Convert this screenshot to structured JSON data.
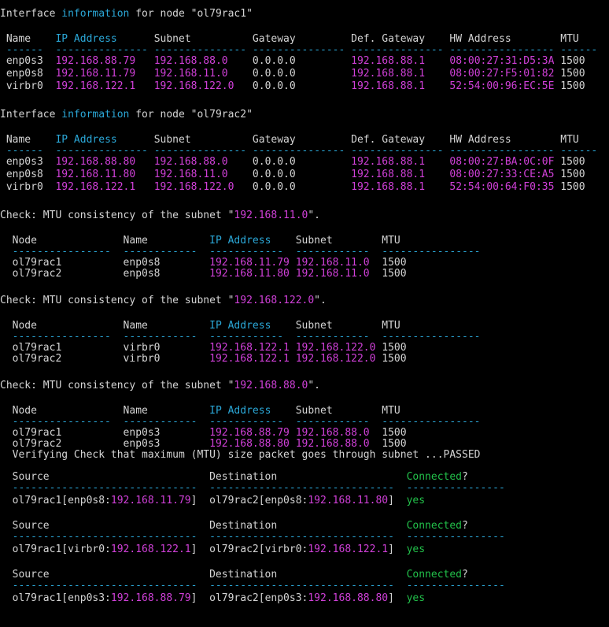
{
  "block1_title_parts": [
    "Interface ",
    "information",
    " for node \"ol79rac1\""
  ],
  "block2_title_parts": [
    "Interface ",
    "information",
    " for node \"ol79rac2\""
  ],
  "iface_headers": [
    "Name",
    "IP Address",
    "Subnet",
    "Gateway",
    "Def. Gateway",
    "HW Address",
    "MTU"
  ],
  "iface_dashes": [
    "------",
    "---------------",
    "---------------",
    "---------------",
    "---------------",
    "-----------------",
    "------"
  ],
  "node1_ifaces": [
    [
      "enp0s3",
      "192.168.88.79",
      "192.168.88.0",
      "0.0.0.0",
      "192.168.88.1",
      "08:00:27:31:D5:3A",
      "1500"
    ],
    [
      "enp0s8",
      "192.168.11.79",
      "192.168.11.0",
      "0.0.0.0",
      "192.168.88.1",
      "08:00:27:F5:01:82",
      "1500"
    ],
    [
      "virbr0",
      "192.168.122.1",
      "192.168.122.0",
      "0.0.0.0",
      "192.168.88.1",
      "52:54:00:96:EC:5E",
      "1500"
    ]
  ],
  "node2_ifaces": [
    [
      "enp0s3",
      "192.168.88.80",
      "192.168.88.0",
      "0.0.0.0",
      "192.168.88.1",
      "08:00:27:BA:0C:0F",
      "1500"
    ],
    [
      "enp0s8",
      "192.168.11.80",
      "192.168.11.0",
      "0.0.0.0",
      "192.168.88.1",
      "08:00:27:33:CE:A5",
      "1500"
    ],
    [
      "virbr0",
      "192.168.122.1",
      "192.168.122.0",
      "0.0.0.0",
      "192.168.88.1",
      "52:54:00:64:F0:35",
      "1500"
    ]
  ],
  "mtu_prefix": "Check: MTU consistency of the subnet \"",
  "mtu_suffix": "\".",
  "mtu_headers": [
    "Node",
    "Name",
    "IP Address",
    "Subnet",
    "MTU"
  ],
  "mtu_dashes": [
    "----------------",
    "------------",
    "------------",
    "------------",
    "----------------"
  ],
  "mtu_checks": [
    {
      "subnet": "192.168.11.0",
      "rows": [
        [
          "ol79rac1",
          "enp0s8",
          "192.168.11.79",
          "192.168.11.0",
          "1500"
        ],
        [
          "ol79rac2",
          "enp0s8",
          "192.168.11.80",
          "192.168.11.0",
          "1500"
        ]
      ]
    },
    {
      "subnet": "192.168.122.0",
      "rows": [
        [
          "ol79rac1",
          "virbr0",
          "192.168.122.1",
          "192.168.122.0",
          "1500"
        ],
        [
          "ol79rac2",
          "virbr0",
          "192.168.122.1",
          "192.168.122.0",
          "1500"
        ]
      ]
    },
    {
      "subnet": "192.168.88.0",
      "rows": [
        [
          "ol79rac1",
          "enp0s3",
          "192.168.88.79",
          "192.168.88.0",
          "1500"
        ],
        [
          "ol79rac2",
          "enp0s3",
          "192.168.88.80",
          "192.168.88.0",
          "1500"
        ]
      ]
    }
  ],
  "verify_line": "Verifying Check that maximum (MTU) size packet goes through subnet ...PASSED",
  "conn_headers": [
    "Source",
    "Destination",
    "Connected?"
  ],
  "conn_dashes": [
    "------------------------------",
    "------------------------------",
    "----------------"
  ],
  "connections": [
    {
      "src_node": "ol79rac1",
      "src_if": "enp0s8",
      "src_ip": "192.168.11.79",
      "dst_node": "ol79rac2",
      "dst_if": "enp0s8",
      "dst_ip": "192.168.11.80",
      "status": "yes"
    },
    {
      "src_node": "ol79rac1",
      "src_if": "virbr0",
      "src_ip": "192.168.122.1",
      "dst_node": "ol79rac2",
      "dst_if": "virbr0",
      "dst_ip": "192.168.122.1",
      "status": "yes"
    },
    {
      "src_node": "ol79rac1",
      "src_if": "enp0s3",
      "src_ip": "192.168.88.79",
      "dst_node": "ol79rac2",
      "dst_if": "enp0s3",
      "dst_ip": "192.168.88.80",
      "status": "yes"
    }
  ],
  "colors": {
    "background": "#000000",
    "text": "#d4d4d4",
    "cyan": "#2ba8d8",
    "magenta": "#d040d8",
    "green": "#22c04a"
  }
}
